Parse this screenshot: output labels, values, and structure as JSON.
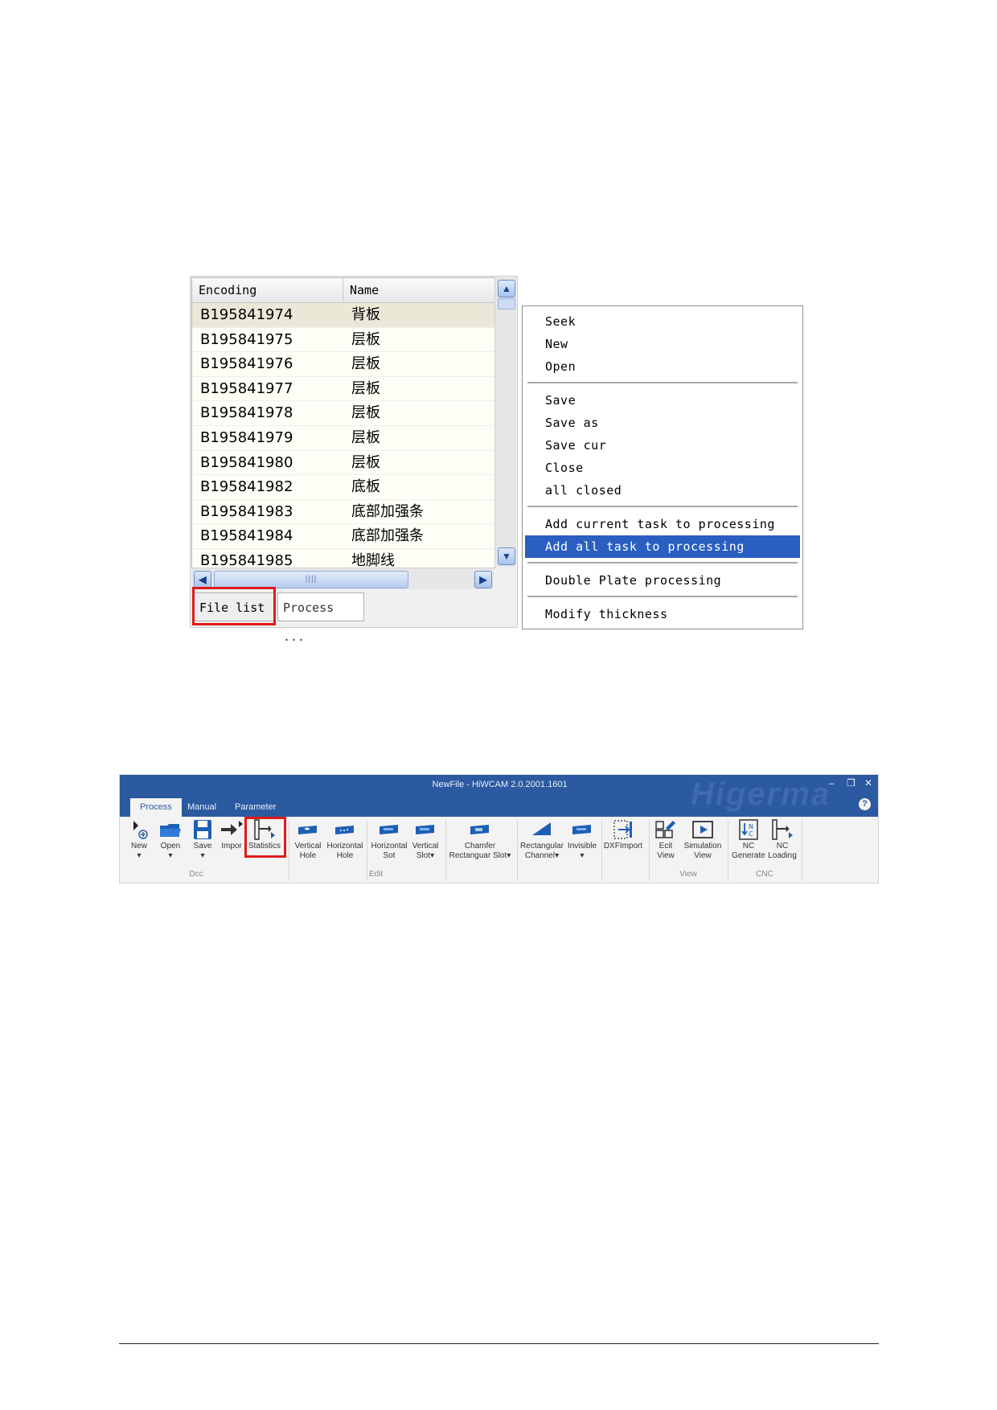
{
  "file_list": {
    "columns": [
      "Encoding",
      "Name"
    ],
    "rows": [
      {
        "encoding": "B195841974",
        "name": "背板"
      },
      {
        "encoding": "B195841975",
        "name": "层板"
      },
      {
        "encoding": "B195841976",
        "name": "层板"
      },
      {
        "encoding": "B195841977",
        "name": "层板"
      },
      {
        "encoding": "B195841978",
        "name": "层板"
      },
      {
        "encoding": "B195841979",
        "name": "层板"
      },
      {
        "encoding": "B195841980",
        "name": "层板"
      },
      {
        "encoding": "B195841982",
        "name": "底板"
      },
      {
        "encoding": "B195841983",
        "name": "底部加强条"
      },
      {
        "encoding": "B195841984",
        "name": "底部加强条"
      },
      {
        "encoding": "B195841985",
        "name": "地脚线"
      }
    ],
    "tabs": {
      "file_list": "File list",
      "process": "Process ..."
    }
  },
  "context_menu": {
    "seek": "Seek",
    "new": "New",
    "open": "Open",
    "save": "Save",
    "save_as": "Save as",
    "save_cur": "Save cur",
    "close": "Close",
    "all_closed": "all closed",
    "add_current": "Add current task to processing",
    "add_all": "Add all task to processing",
    "double_plate": "Double Plate processing",
    "modify_thickness": "Modify thickness"
  },
  "ribbon": {
    "title": "NewFile - HiWCAM 2.0.2001.1601",
    "watermark": "Higerma",
    "tabs": {
      "process": "Process",
      "manual": "Manual",
      "parameter": "Parameter"
    },
    "tools": {
      "new": "New",
      "open": "Open",
      "save": "Save",
      "import": "Impor",
      "statistics": "Statistics",
      "vertical_hole_1": "Vertical",
      "vertical_hole_2": "Hole",
      "horizontal_hole_1": "Horizontal",
      "horizontal_hole_2": "Hole",
      "horizontal_slot_1": "Horizontal",
      "horizontal_slot_2": "Sot",
      "vertical_slot_1": "Vertical",
      "vertical_slot_2": "Slot",
      "chamfer_1": "Chamfer",
      "chamfer_2": "Rectanguar Slot",
      "rect_channel_1": "Rectangular",
      "rect_channel_2": "Channel",
      "invisible": "Invisible",
      "dxf_import": "DXFImport",
      "edit_view_1": "Ecit",
      "edit_view_2": "View",
      "sim_view_1": "Simulation",
      "sim_view_2": "View",
      "nc_gen_1": "NC",
      "nc_gen_2": "Generate",
      "nc_load_1": "NC",
      "nc_load_2": "Loading"
    },
    "groups": {
      "doc": "Dcc",
      "edit": "Edit",
      "view": "View",
      "cnc": "CNC"
    },
    "colors": {
      "title_bar": "#2c5aa0",
      "highlight": "#e11a1a"
    }
  }
}
